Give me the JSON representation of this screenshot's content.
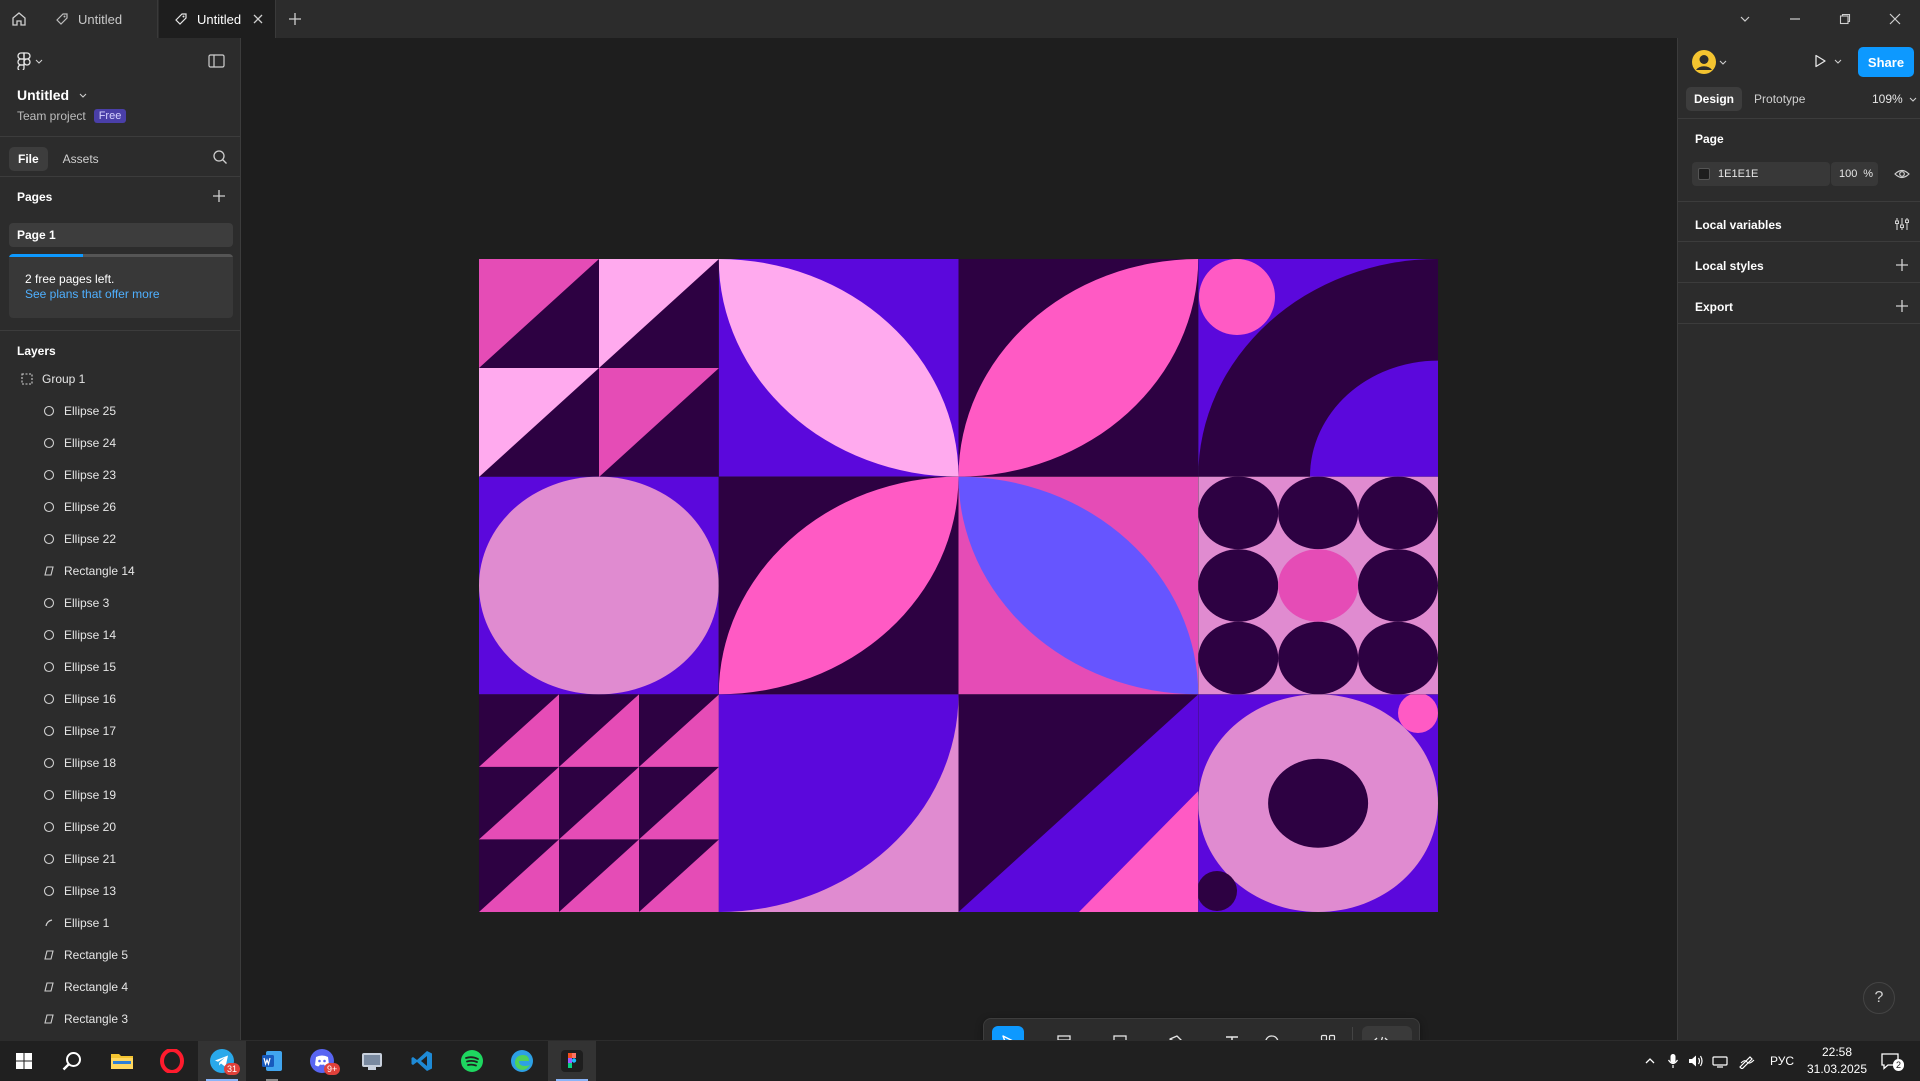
{
  "titlebar": {
    "tabs": [
      {
        "label": "Untitled",
        "active": false
      },
      {
        "label": "Untitled",
        "active": true
      }
    ]
  },
  "left_panel": {
    "file_title": "Untitled",
    "team_label": "Team project",
    "plan_badge": "Free",
    "tabs": [
      "File",
      "Assets"
    ],
    "pages_heading": "Pages",
    "pages": [
      "Page 1"
    ],
    "promo": {
      "text": "2 free pages left.",
      "link": "See plans that offer more",
      "progress": 0.33
    },
    "layers_heading": "Layers",
    "layers": [
      {
        "name": "Group 1",
        "icon": "frame-icon",
        "indent": 0
      },
      {
        "name": "Ellipse 25",
        "icon": "ellipse-icon",
        "indent": 1
      },
      {
        "name": "Ellipse 24",
        "icon": "ellipse-icon",
        "indent": 1
      },
      {
        "name": "Ellipse 23",
        "icon": "ellipse-icon",
        "indent": 1
      },
      {
        "name": "Ellipse 26",
        "icon": "ellipse-icon",
        "indent": 1
      },
      {
        "name": "Ellipse 22",
        "icon": "ellipse-icon",
        "indent": 1
      },
      {
        "name": "Rectangle 14",
        "icon": "vector-icon",
        "indent": 1
      },
      {
        "name": "Ellipse 3",
        "icon": "ellipse-icon",
        "indent": 1
      },
      {
        "name": "Ellipse 14",
        "icon": "ellipse-icon",
        "indent": 1
      },
      {
        "name": "Ellipse 15",
        "icon": "ellipse-icon",
        "indent": 1
      },
      {
        "name": "Ellipse 16",
        "icon": "ellipse-icon",
        "indent": 1
      },
      {
        "name": "Ellipse 17",
        "icon": "ellipse-icon",
        "indent": 1
      },
      {
        "name": "Ellipse 18",
        "icon": "ellipse-icon",
        "indent": 1
      },
      {
        "name": "Ellipse 19",
        "icon": "ellipse-icon",
        "indent": 1
      },
      {
        "name": "Ellipse 20",
        "icon": "ellipse-icon",
        "indent": 1
      },
      {
        "name": "Ellipse 21",
        "icon": "ellipse-icon",
        "indent": 1
      },
      {
        "name": "Ellipse 13",
        "icon": "ellipse-icon",
        "indent": 1
      },
      {
        "name": "Ellipse 1",
        "icon": "arc-icon",
        "indent": 1
      },
      {
        "name": "Rectangle 5",
        "icon": "vector-icon",
        "indent": 1
      },
      {
        "name": "Rectangle 4",
        "icon": "vector-icon",
        "indent": 1
      },
      {
        "name": "Rectangle 3",
        "icon": "vector-icon",
        "indent": 1
      }
    ]
  },
  "right_panel": {
    "share_label": "Share",
    "tabs": [
      "Design",
      "Prototype"
    ],
    "zoom": "109%",
    "page_heading": "Page",
    "page_color": "1E1E1E",
    "page_opacity": "100",
    "opacity_unit": "%",
    "sections": [
      "Local variables",
      "Local styles",
      "Export"
    ],
    "help": "?"
  },
  "taskbar": {
    "language": "РУС",
    "time": "22:58",
    "date": "31.03.2025",
    "telegram_badge": "31",
    "discord_badge": "9+",
    "notification_count": "2"
  },
  "colors": {
    "accent": "#0d99ff",
    "dark_purple": "#2d0142",
    "violet": "#5b08dc",
    "hot_pink": "#ff5ac4",
    "light_pink": "#ffaaee",
    "magenta": "#e54cb6",
    "mauve": "#e08bd0",
    "periwinkle": "#6655ff"
  }
}
